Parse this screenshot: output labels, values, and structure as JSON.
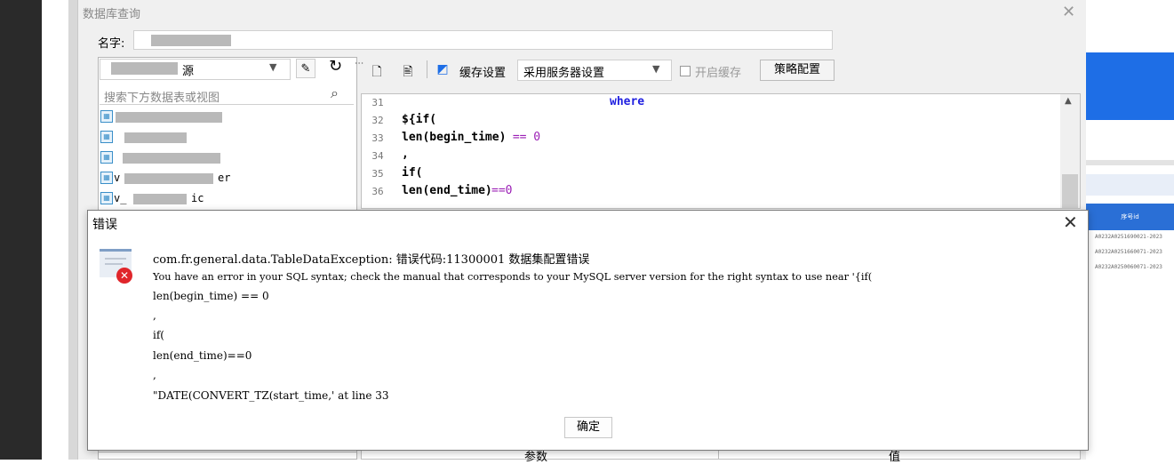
{
  "db_window": {
    "title": "数据库查询",
    "close_glyph": "✕",
    "name_label": "名字:",
    "datasource_suffix": "源",
    "search_placeholder": "搜索下方数据表或视图",
    "tree_items": [
      {
        "text_a": "v",
        "text_b": "er"
      },
      {
        "text_a": "v_",
        "text_b": "ic"
      }
    ],
    "toolbar": {
      "cache_settings_label": "缓存设置",
      "cache_mode_value": "采用服务器设置",
      "enable_cache_label": "开启缓存",
      "strategy_button_label": "策略配置"
    },
    "editor": {
      "lines": [
        {
          "num": "31",
          "text": "where"
        },
        {
          "num": "32",
          "text": "${if("
        },
        {
          "num": "33",
          "text_a": "len(begin_time)",
          "text_b": " == 0"
        },
        {
          "num": "34",
          "text": ","
        },
        {
          "num": "35",
          "text": "if("
        },
        {
          "num": "36",
          "text_a": "len(end_time)",
          "text_b": "==0"
        },
        {
          "num": "37",
          "text": ""
        }
      ]
    },
    "params_table": {
      "col_param": "参数",
      "col_value": "值"
    }
  },
  "error_dialog": {
    "title": "错误",
    "close_glyph": "✕",
    "lines": [
      "com.fr.general.data.TableDataException: 错误代码:11300001 数据集配置错误",
      "You have an error in your SQL syntax; check the manual that corresponds to your MySQL server version for the right syntax to use near '{if(",
      "len(begin_time) == 0",
      ",",
      "if(",
      "len(end_time)==0",
      ",",
      "\"DATE(CONVERT_TZ(start_time,' at line 33"
    ],
    "ok_button_label": "确定"
  },
  "background_app": {
    "header_label": "序号id",
    "rows": [
      "A0232A0251690021-2023",
      "A0232A0251660071-2023",
      "A0232A0250060071-2023"
    ]
  },
  "colors": {
    "keyword_blue": "#2020e0",
    "paren_purple": "#9b1fb5",
    "error_red": "#e0262b",
    "brand_blue": "#1e6ee6"
  }
}
